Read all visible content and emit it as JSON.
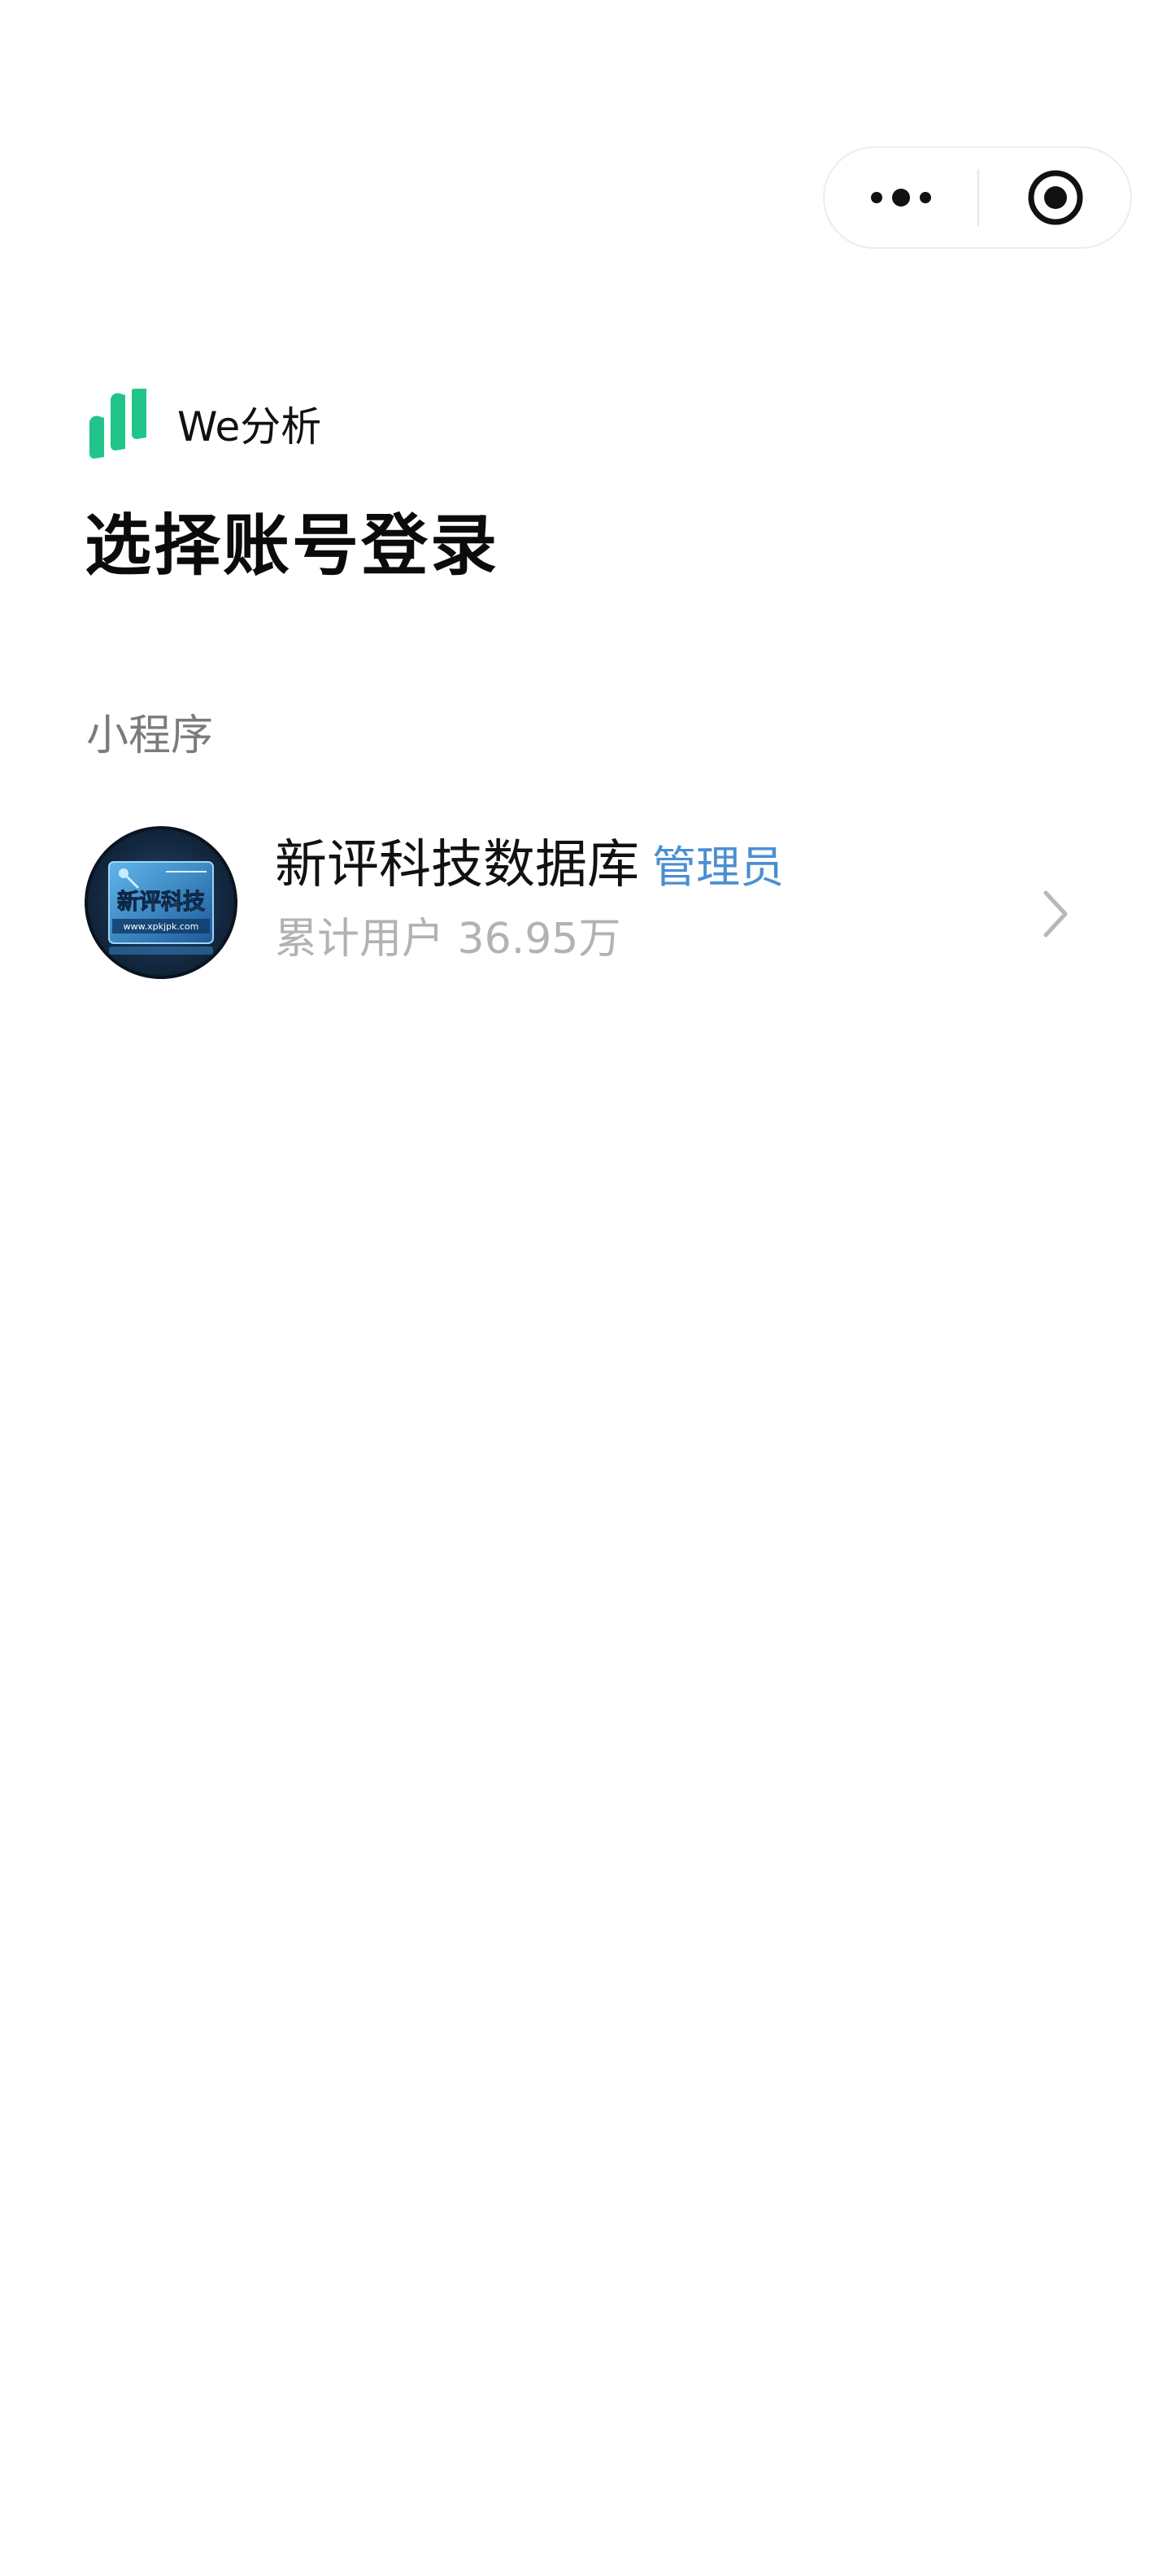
{
  "capsule": {
    "more_icon": "more-dots-icon",
    "close_icon": "target-close-icon"
  },
  "app": {
    "name": "We分析",
    "logo_icon": "we-analytics-logo",
    "accent_color": "#22c48a"
  },
  "page": {
    "title": "选择账号登录"
  },
  "section": {
    "label": "小程序"
  },
  "accounts": [
    {
      "name": "新评科技数据库",
      "role": "管理员",
      "users": "累计用户 36.95万",
      "avatar_text": "新评科技",
      "avatar_url_text": "www.xpkjpk.com",
      "chevron_icon": "chevron-right-icon"
    }
  ],
  "colors": {
    "role": "#4b8fd1",
    "secondary_text": "#b2b2b2",
    "section_label": "#7b7b7b"
  }
}
